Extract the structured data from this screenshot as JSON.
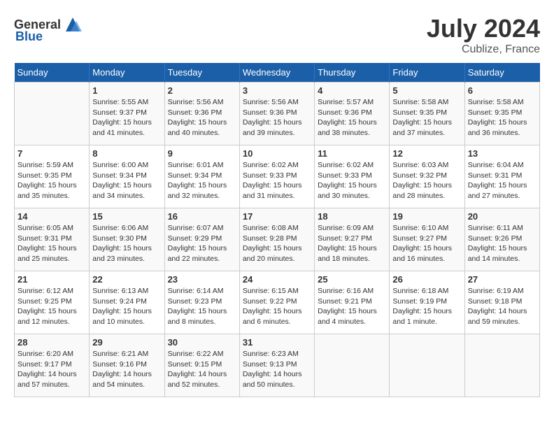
{
  "header": {
    "logo_general": "General",
    "logo_blue": "Blue",
    "month_year": "July 2024",
    "location": "Cublize, France"
  },
  "days_of_week": [
    "Sunday",
    "Monday",
    "Tuesday",
    "Wednesday",
    "Thursday",
    "Friday",
    "Saturday"
  ],
  "weeks": [
    [
      {
        "day": "",
        "sunrise": "",
        "sunset": "",
        "daylight": ""
      },
      {
        "day": "1",
        "sunrise": "Sunrise: 5:55 AM",
        "sunset": "Sunset: 9:37 PM",
        "daylight": "Daylight: 15 hours and 41 minutes."
      },
      {
        "day": "2",
        "sunrise": "Sunrise: 5:56 AM",
        "sunset": "Sunset: 9:36 PM",
        "daylight": "Daylight: 15 hours and 40 minutes."
      },
      {
        "day": "3",
        "sunrise": "Sunrise: 5:56 AM",
        "sunset": "Sunset: 9:36 PM",
        "daylight": "Daylight: 15 hours and 39 minutes."
      },
      {
        "day": "4",
        "sunrise": "Sunrise: 5:57 AM",
        "sunset": "Sunset: 9:36 PM",
        "daylight": "Daylight: 15 hours and 38 minutes."
      },
      {
        "day": "5",
        "sunrise": "Sunrise: 5:58 AM",
        "sunset": "Sunset: 9:35 PM",
        "daylight": "Daylight: 15 hours and 37 minutes."
      },
      {
        "day": "6",
        "sunrise": "Sunrise: 5:58 AM",
        "sunset": "Sunset: 9:35 PM",
        "daylight": "Daylight: 15 hours and 36 minutes."
      }
    ],
    [
      {
        "day": "7",
        "sunrise": "Sunrise: 5:59 AM",
        "sunset": "Sunset: 9:35 PM",
        "daylight": "Daylight: 15 hours and 35 minutes."
      },
      {
        "day": "8",
        "sunrise": "Sunrise: 6:00 AM",
        "sunset": "Sunset: 9:34 PM",
        "daylight": "Daylight: 15 hours and 34 minutes."
      },
      {
        "day": "9",
        "sunrise": "Sunrise: 6:01 AM",
        "sunset": "Sunset: 9:34 PM",
        "daylight": "Daylight: 15 hours and 32 minutes."
      },
      {
        "day": "10",
        "sunrise": "Sunrise: 6:02 AM",
        "sunset": "Sunset: 9:33 PM",
        "daylight": "Daylight: 15 hours and 31 minutes."
      },
      {
        "day": "11",
        "sunrise": "Sunrise: 6:02 AM",
        "sunset": "Sunset: 9:33 PM",
        "daylight": "Daylight: 15 hours and 30 minutes."
      },
      {
        "day": "12",
        "sunrise": "Sunrise: 6:03 AM",
        "sunset": "Sunset: 9:32 PM",
        "daylight": "Daylight: 15 hours and 28 minutes."
      },
      {
        "day": "13",
        "sunrise": "Sunrise: 6:04 AM",
        "sunset": "Sunset: 9:31 PM",
        "daylight": "Daylight: 15 hours and 27 minutes."
      }
    ],
    [
      {
        "day": "14",
        "sunrise": "Sunrise: 6:05 AM",
        "sunset": "Sunset: 9:31 PM",
        "daylight": "Daylight: 15 hours and 25 minutes."
      },
      {
        "day": "15",
        "sunrise": "Sunrise: 6:06 AM",
        "sunset": "Sunset: 9:30 PM",
        "daylight": "Daylight: 15 hours and 23 minutes."
      },
      {
        "day": "16",
        "sunrise": "Sunrise: 6:07 AM",
        "sunset": "Sunset: 9:29 PM",
        "daylight": "Daylight: 15 hours and 22 minutes."
      },
      {
        "day": "17",
        "sunrise": "Sunrise: 6:08 AM",
        "sunset": "Sunset: 9:28 PM",
        "daylight": "Daylight: 15 hours and 20 minutes."
      },
      {
        "day": "18",
        "sunrise": "Sunrise: 6:09 AM",
        "sunset": "Sunset: 9:27 PM",
        "daylight": "Daylight: 15 hours and 18 minutes."
      },
      {
        "day": "19",
        "sunrise": "Sunrise: 6:10 AM",
        "sunset": "Sunset: 9:27 PM",
        "daylight": "Daylight: 15 hours and 16 minutes."
      },
      {
        "day": "20",
        "sunrise": "Sunrise: 6:11 AM",
        "sunset": "Sunset: 9:26 PM",
        "daylight": "Daylight: 15 hours and 14 minutes."
      }
    ],
    [
      {
        "day": "21",
        "sunrise": "Sunrise: 6:12 AM",
        "sunset": "Sunset: 9:25 PM",
        "daylight": "Daylight: 15 hours and 12 minutes."
      },
      {
        "day": "22",
        "sunrise": "Sunrise: 6:13 AM",
        "sunset": "Sunset: 9:24 PM",
        "daylight": "Daylight: 15 hours and 10 minutes."
      },
      {
        "day": "23",
        "sunrise": "Sunrise: 6:14 AM",
        "sunset": "Sunset: 9:23 PM",
        "daylight": "Daylight: 15 hours and 8 minutes."
      },
      {
        "day": "24",
        "sunrise": "Sunrise: 6:15 AM",
        "sunset": "Sunset: 9:22 PM",
        "daylight": "Daylight: 15 hours and 6 minutes."
      },
      {
        "day": "25",
        "sunrise": "Sunrise: 6:16 AM",
        "sunset": "Sunset: 9:21 PM",
        "daylight": "Daylight: 15 hours and 4 minutes."
      },
      {
        "day": "26",
        "sunrise": "Sunrise: 6:18 AM",
        "sunset": "Sunset: 9:19 PM",
        "daylight": "Daylight: 15 hours and 1 minute."
      },
      {
        "day": "27",
        "sunrise": "Sunrise: 6:19 AM",
        "sunset": "Sunset: 9:18 PM",
        "daylight": "Daylight: 14 hours and 59 minutes."
      }
    ],
    [
      {
        "day": "28",
        "sunrise": "Sunrise: 6:20 AM",
        "sunset": "Sunset: 9:17 PM",
        "daylight": "Daylight: 14 hours and 57 minutes."
      },
      {
        "day": "29",
        "sunrise": "Sunrise: 6:21 AM",
        "sunset": "Sunset: 9:16 PM",
        "daylight": "Daylight: 14 hours and 54 minutes."
      },
      {
        "day": "30",
        "sunrise": "Sunrise: 6:22 AM",
        "sunset": "Sunset: 9:15 PM",
        "daylight": "Daylight: 14 hours and 52 minutes."
      },
      {
        "day": "31",
        "sunrise": "Sunrise: 6:23 AM",
        "sunset": "Sunset: 9:13 PM",
        "daylight": "Daylight: 14 hours and 50 minutes."
      },
      {
        "day": "",
        "sunrise": "",
        "sunset": "",
        "daylight": ""
      },
      {
        "day": "",
        "sunrise": "",
        "sunset": "",
        "daylight": ""
      },
      {
        "day": "",
        "sunrise": "",
        "sunset": "",
        "daylight": ""
      }
    ]
  ]
}
